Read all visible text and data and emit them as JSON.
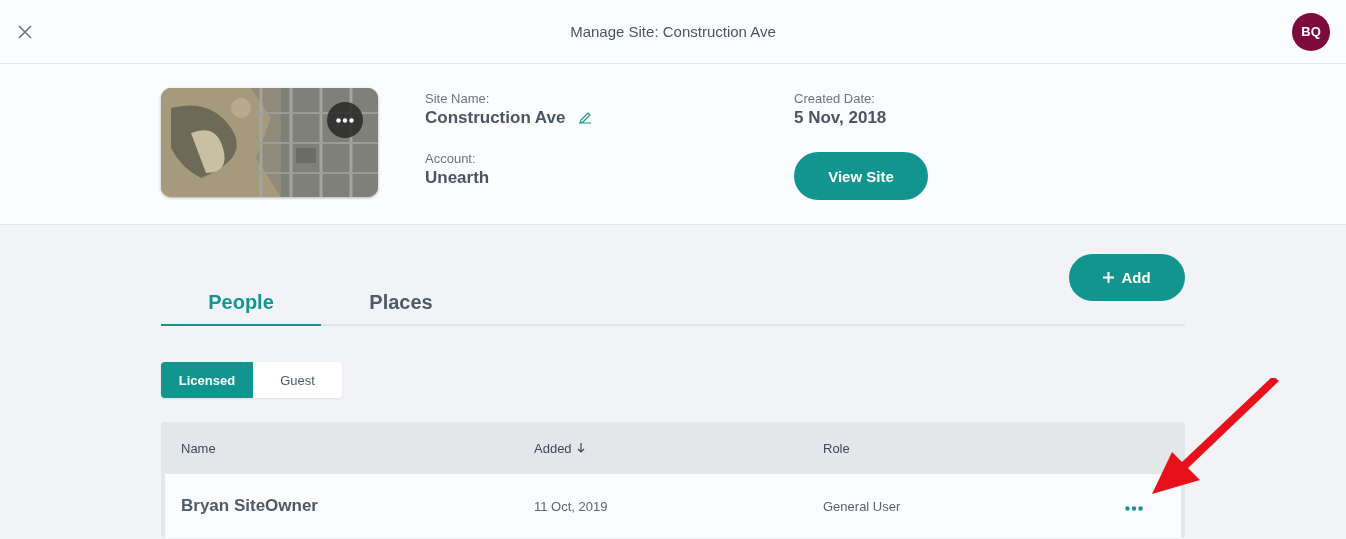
{
  "header": {
    "title": "Manage Site: Construction Ave",
    "avatar": "BQ"
  },
  "site": {
    "fields": [
      {
        "label": "Site Name:",
        "value": "Construction Ave",
        "editable": true
      },
      {
        "label": "Account:",
        "value": "Unearth",
        "editable": false
      },
      {
        "label": "Created Date:",
        "value": "5 Nov, 2018",
        "editable": false
      }
    ],
    "view_button": "View Site"
  },
  "tabs": [
    {
      "label": "People",
      "selected": true
    },
    {
      "label": "Places",
      "selected": false
    }
  ],
  "add_button": "Add",
  "segments": [
    {
      "label": "Licensed",
      "selected": true
    },
    {
      "label": "Guest",
      "selected": false
    }
  ],
  "table": {
    "columns": [
      {
        "label": "Name",
        "sorted": false
      },
      {
        "label": "Added",
        "sorted": true
      },
      {
        "label": "Role",
        "sorted": false
      }
    ],
    "rows": [
      {
        "name": "Bryan SiteOwner",
        "added": "11 Oct, 2019",
        "role": "General User"
      }
    ]
  }
}
